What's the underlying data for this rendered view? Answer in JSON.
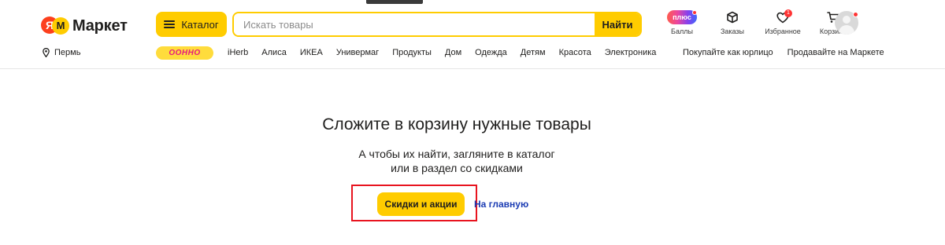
{
  "header": {
    "logo": {
      "ya": "Я",
      "m": "М",
      "text": "Маркет"
    },
    "catalog_label": "Каталог",
    "search": {
      "placeholder": "Искать товары",
      "value": "",
      "button_label": "Найти"
    },
    "icons": [
      {
        "name": "plus-points",
        "label": "Баллы",
        "badge_text": "плюс",
        "icon": "plus-badge-icon"
      },
      {
        "name": "orders",
        "label": "Заказы",
        "icon": "box-icon"
      },
      {
        "name": "favorites",
        "label": "Избранное",
        "icon": "heart-icon",
        "count": "1"
      },
      {
        "name": "cart",
        "label": "Корзина",
        "icon": "cart-icon"
      }
    ],
    "avatar": {
      "icon": "user-avatar-icon",
      "notification_color": "#ff3333"
    }
  },
  "nav": {
    "location": "Пермь",
    "promo_badge_text": "OOHHO",
    "links": [
      "iHerb",
      "Алиса",
      "ИКЕА",
      "Универмаг",
      "Продукты",
      "Дом",
      "Одежда",
      "Детям",
      "Красота",
      "Электроника"
    ],
    "right_links": [
      "Покупайте как юрлицо",
      "Продавайте на Маркете"
    ]
  },
  "main": {
    "title": "Сложите в корзину нужные товары",
    "subtitle_line1": "А чтобы их найти, загляните в каталог",
    "subtitle_line2": "или в раздел со скидками",
    "deals_button": "Скидки и акции",
    "home_link": "На главную"
  },
  "colors": {
    "accent_yellow": "#ffcc00",
    "highlight_red": "#e8141f",
    "link_blue": "#1a3bb3",
    "ya_red": "#fc3f1d"
  }
}
